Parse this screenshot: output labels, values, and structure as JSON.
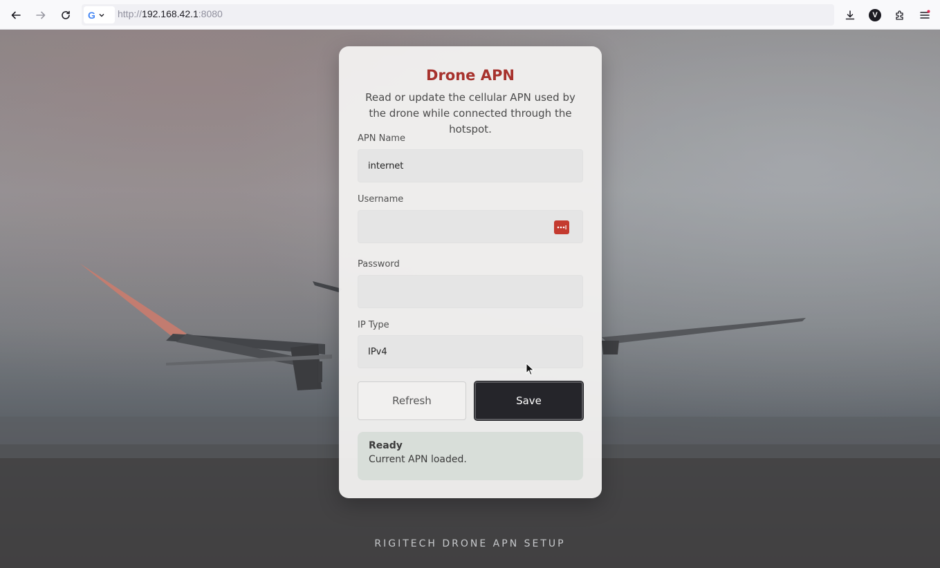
{
  "browser": {
    "url_scheme": "http://",
    "url_host": "192.168.42.1",
    "url_port": ":8080",
    "profile_initial": "V",
    "site_logo": "G"
  },
  "icons": {
    "back": "arrow-left-icon",
    "forward": "arrow-right-icon",
    "reload": "reload-icon",
    "downloads": "download-icon",
    "extensions": "puzzle-icon",
    "menu": "hamburger-icon",
    "password_manager": "password-manager-icon"
  },
  "card": {
    "title": "Drone APN",
    "subtitle": "Read or update the cellular APN used by the drone while connected through the hotspot."
  },
  "form": {
    "apn_label": "APN Name",
    "apn_value": "internet",
    "username_label": "Username",
    "username_value": "",
    "password_label": "Password",
    "password_value": "",
    "iptype_label": "IP Type",
    "iptype_value": "IPv4"
  },
  "buttons": {
    "refresh": "Refresh",
    "save": "Save"
  },
  "status": {
    "title": "Ready",
    "message": "Current APN loaded."
  },
  "footer": {
    "text": "RIGITECH DRONE APN SETUP"
  },
  "colors": {
    "accent": "#a7322d",
    "save_button": "#25252a",
    "status_bg": "#d8ded9"
  }
}
